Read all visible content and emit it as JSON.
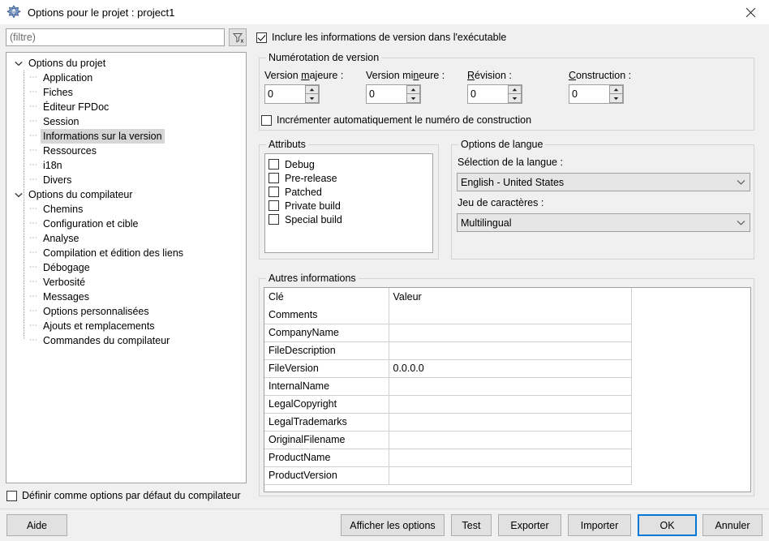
{
  "window": {
    "title": "Options pour le projet : project1",
    "icon": "lazarus-app-icon",
    "close_label": "×"
  },
  "sidebar": {
    "filter": {
      "placeholder": "(filtre)",
      "value": "",
      "clear_button_icon": "filter-clear-icon"
    },
    "tree": [
      {
        "label": "Options du projet",
        "level": 0,
        "expanded": true,
        "selected": false
      },
      {
        "label": "Application",
        "level": 1,
        "expanded": null,
        "selected": false
      },
      {
        "label": "Fiches",
        "level": 1,
        "expanded": null,
        "selected": false
      },
      {
        "label": "Éditeur FPDoc",
        "level": 1,
        "expanded": null,
        "selected": false
      },
      {
        "label": "Session",
        "level": 1,
        "expanded": null,
        "selected": false
      },
      {
        "label": "Informations sur la version",
        "level": 1,
        "expanded": null,
        "selected": true
      },
      {
        "label": "Ressources",
        "level": 1,
        "expanded": null,
        "selected": false
      },
      {
        "label": "i18n",
        "level": 1,
        "expanded": null,
        "selected": false
      },
      {
        "label": "Divers",
        "level": 1,
        "expanded": null,
        "selected": false
      },
      {
        "label": "Options du compilateur",
        "level": 0,
        "expanded": true,
        "selected": false
      },
      {
        "label": "Chemins",
        "level": 1,
        "expanded": null,
        "selected": false
      },
      {
        "label": "Configuration et cible",
        "level": 1,
        "expanded": null,
        "selected": false
      },
      {
        "label": "Analyse",
        "level": 1,
        "expanded": null,
        "selected": false
      },
      {
        "label": "Compilation et édition des liens",
        "level": 1,
        "expanded": null,
        "selected": false
      },
      {
        "label": "Débogage",
        "level": 1,
        "expanded": null,
        "selected": false
      },
      {
        "label": "Verbosité",
        "level": 1,
        "expanded": null,
        "selected": false
      },
      {
        "label": "Messages",
        "level": 1,
        "expanded": null,
        "selected": false
      },
      {
        "label": "Options personnalisées",
        "level": 1,
        "expanded": null,
        "selected": false
      },
      {
        "label": "Ajouts et remplacements",
        "level": 1,
        "expanded": null,
        "selected": false
      },
      {
        "label": "Commandes du compilateur",
        "level": 1,
        "expanded": null,
        "selected": false
      }
    ],
    "default_options_checkbox": {
      "label": "Définir comme options par défaut du compilateur",
      "checked": false
    }
  },
  "main": {
    "include_version_checkbox": {
      "label": "Inclure les informations de version dans l'exécutable",
      "checked": true
    },
    "version_group": {
      "title": "Numérotation de version",
      "fields": [
        {
          "label": "Version majeure :",
          "value": "0"
        },
        {
          "label": "Version mineure :",
          "value": "0"
        },
        {
          "label": "Révision :",
          "value": "0"
        },
        {
          "label": "Construction :",
          "value": "0"
        }
      ],
      "auto_increment_checkbox": {
        "label": "Incrémenter automatiquement le numéro de construction",
        "checked": false
      }
    },
    "attributes_group": {
      "title": "Attributs",
      "items": [
        {
          "label": "Debug",
          "checked": false
        },
        {
          "label": "Pre-release",
          "checked": false
        },
        {
          "label": "Patched",
          "checked": false
        },
        {
          "label": "Private build",
          "checked": false
        },
        {
          "label": "Special build",
          "checked": false
        }
      ]
    },
    "language_group": {
      "title": "Options de langue",
      "language_label": "Sélection de la langue :",
      "language_value": "English - United States",
      "charset_label": "Jeu de caractères :",
      "charset_value": "Multilingual"
    },
    "other_info_group": {
      "title": "Autres informations",
      "columns": [
        "Clé",
        "Valeur"
      ],
      "rows": [
        {
          "key": "Comments",
          "value": ""
        },
        {
          "key": "CompanyName",
          "value": ""
        },
        {
          "key": "FileDescription",
          "value": ""
        },
        {
          "key": "FileVersion",
          "value": "0.0.0.0"
        },
        {
          "key": "InternalName",
          "value": ""
        },
        {
          "key": "LegalCopyright",
          "value": ""
        },
        {
          "key": "LegalTrademarks",
          "value": ""
        },
        {
          "key": "OriginalFilename",
          "value": ""
        },
        {
          "key": "ProductName",
          "value": ""
        },
        {
          "key": "ProductVersion",
          "value": ""
        }
      ]
    }
  },
  "footer": {
    "help": "Aide",
    "show_options": "Afficher les options",
    "test": "Test",
    "export": "Exporter",
    "import": "Importer",
    "ok": "OK",
    "cancel": "Annuler"
  },
  "colors": {
    "window_bg": "#f0f0f0",
    "accent_focus": "#0078d7",
    "selection": "#d6d6d6",
    "combo_bg": "#e6e6e6",
    "button_bg": "#e1e1e1"
  }
}
